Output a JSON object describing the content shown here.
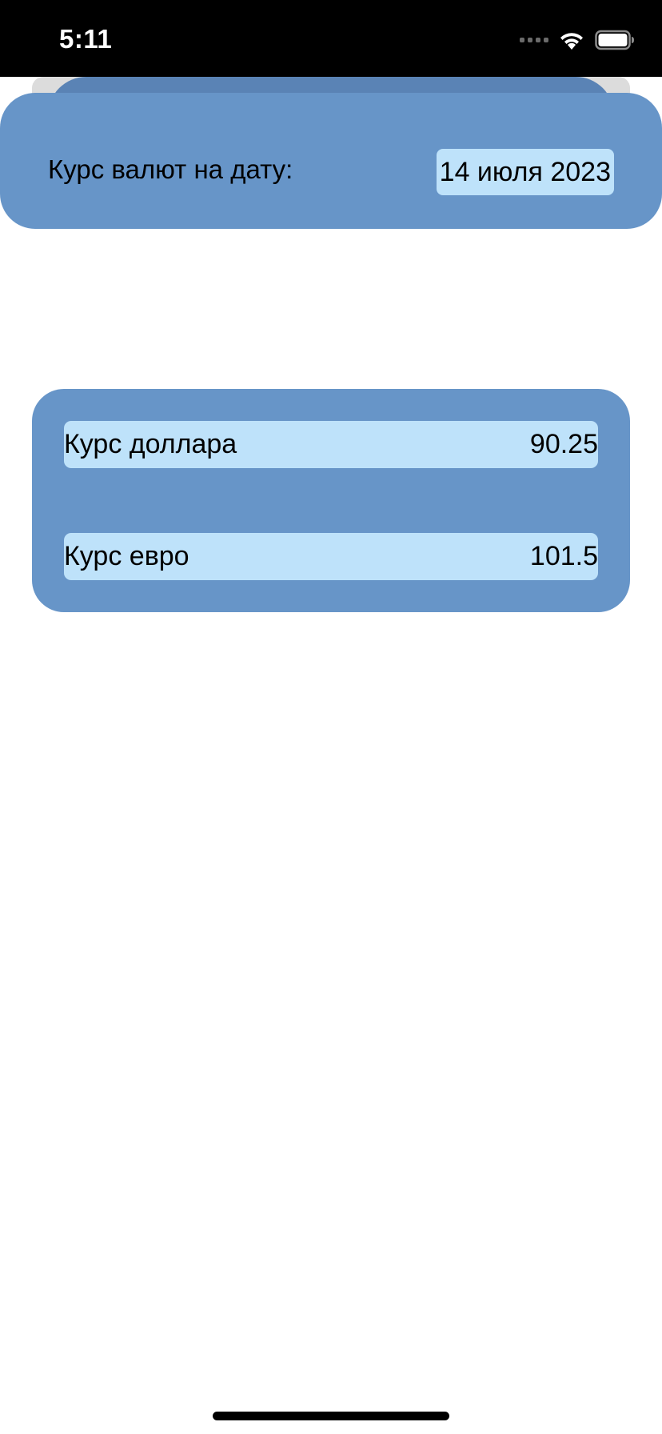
{
  "status_bar": {
    "time": "5:11",
    "icons": [
      "signal-dots-icon",
      "wifi-icon",
      "battery-icon"
    ]
  },
  "header": {
    "label": "Курс валют на дату:",
    "date": "14 июля 2023"
  },
  "rates": [
    {
      "label": "Курс доллара",
      "value": "90.25"
    },
    {
      "label": "Курс евро",
      "value": "101.5"
    }
  ],
  "colors": {
    "card": "#6795c8",
    "chip": "#bee2fa",
    "status_bar": "#000000",
    "background": "#ffffff"
  }
}
